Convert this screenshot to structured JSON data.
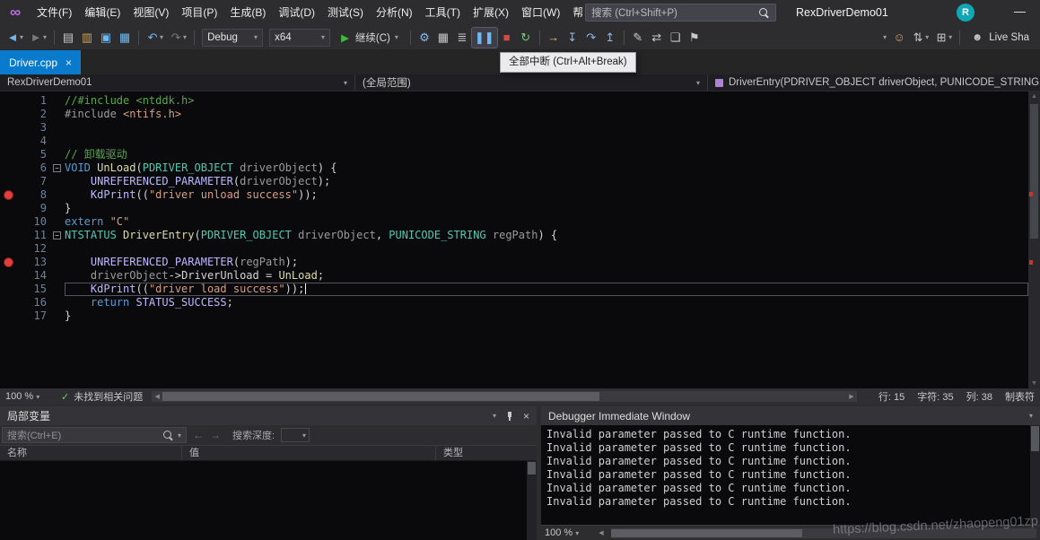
{
  "icons": {
    "chevron": "▾",
    "close": "×",
    "check": "✓",
    "minimize": "—",
    "logo": "∞",
    "scroll_left": "◀",
    "scroll_right": "▶",
    "scroll_up": "▲",
    "scroll_down": "▼",
    "fold_collapse": "−"
  },
  "title_bar": {
    "menus": [
      "文件(F)",
      "编辑(E)",
      "视图(V)",
      "项目(P)",
      "生成(B)",
      "调试(D)",
      "测试(S)",
      "分析(N)",
      "工具(T)",
      "扩展(X)",
      "窗口(W)",
      "帮助(H)"
    ],
    "search_placeholder": "搜索 (Ctrl+Shift+P)",
    "window_title": "RexDriverDemo01",
    "avatar_letter": "R"
  },
  "toolbar": {
    "items": [
      {
        "type": "icon",
        "name": "nav-back-icon",
        "glyph": "◄",
        "color": "#6fb8f2",
        "chev": true
      },
      {
        "type": "icon",
        "name": "nav-forward-icon",
        "glyph": "►",
        "color": "#7a7a7a",
        "chev": true
      },
      {
        "type": "sep"
      },
      {
        "type": "icon",
        "name": "new-file-icon",
        "glyph": "▤",
        "color": "#c8c8c8"
      },
      {
        "type": "icon",
        "name": "open-file-icon",
        "glyph": "▥",
        "color": "#c8a35a"
      },
      {
        "type": "icon",
        "name": "save-icon",
        "glyph": "▣",
        "color": "#6fb8f2"
      },
      {
        "type": "icon",
        "name": "save-all-icon",
        "glyph": "▦",
        "color": "#6fb8f2"
      },
      {
        "type": "sep"
      },
      {
        "type": "icon",
        "name": "undo-icon",
        "glyph": "↶",
        "color": "#6fb8f2",
        "chev": true
      },
      {
        "type": "icon",
        "name": "redo-icon",
        "glyph": "↷",
        "color": "#7a7a7a",
        "chev": true
      },
      {
        "type": "sep"
      },
      {
        "type": "combo",
        "name": "solution-config-dropdown",
        "label": "Debug"
      },
      {
        "type": "combo",
        "name": "platform-dropdown",
        "label": "x64"
      },
      {
        "type": "run",
        "name": "continue-button",
        "glyph": "▶",
        "color": "#3fba41",
        "label": "继续(C)",
        "chev": true
      },
      {
        "type": "sep"
      },
      {
        "type": "icon",
        "name": "quick-attach-icon",
        "glyph": "⚙",
        "color": "#8ab6e8"
      },
      {
        "type": "icon",
        "name": "preview-window-icon",
        "glyph": "▦",
        "color": "#c8c8c8"
      },
      {
        "type": "icon",
        "name": "task-list-icon",
        "glyph": "≣",
        "color": "#c8c8c8"
      },
      {
        "type": "icon",
        "name": "break-all-icon",
        "glyph": "❚❚",
        "color": "#6fb8f2",
        "active": true
      },
      {
        "type": "icon",
        "name": "stop-debug-icon",
        "glyph": "■",
        "color": "#d64a43"
      },
      {
        "type": "icon",
        "name": "restart-debug-icon",
        "glyph": "↻",
        "color": "#7fc97f"
      },
      {
        "type": "sep"
      },
      {
        "type": "icon",
        "name": "show-next-statement-icon",
        "glyph": "→",
        "color": "#d8c36a"
      },
      {
        "type": "icon",
        "name": "step-into-icon",
        "glyph": "↧",
        "color": "#8ab6e8"
      },
      {
        "type": "icon",
        "name": "step-over-icon",
        "glyph": "↷",
        "color": "#8ab6e8"
      },
      {
        "type": "icon",
        "name": "step-out-icon",
        "glyph": "↥",
        "color": "#8ab6e8"
      },
      {
        "type": "sep"
      },
      {
        "type": "icon",
        "name": "code-cleanup-icon",
        "glyph": "✎",
        "color": "#c8c8c8"
      },
      {
        "type": "icon",
        "name": "sync-icon",
        "glyph": "⇄",
        "color": "#c8c8c8"
      },
      {
        "type": "icon",
        "name": "comment-icon",
        "glyph": "❏",
        "color": "#c8c8c8"
      },
      {
        "type": "icon",
        "name": "bookmark-icon",
        "glyph": "⚑",
        "color": "#c8c8c8"
      },
      {
        "type": "spacer"
      },
      {
        "type": "chev",
        "name": "toolbar-options-dropdown"
      },
      {
        "type": "icon",
        "name": "feedback-icon",
        "glyph": "☺",
        "color": "#d9a15e"
      },
      {
        "type": "icon",
        "name": "source-control-icon",
        "glyph": "⇅",
        "color": "#c8c8c8",
        "chev": true
      },
      {
        "type": "icon",
        "name": "window-layout-icon",
        "glyph": "⊞",
        "color": "#c8c8c8",
        "chev": true
      },
      {
        "type": "sep"
      },
      {
        "type": "label-icon",
        "name": "live-share-button",
        "glyph": "☻",
        "color": "#c8c8c8",
        "label": "Live Sha"
      }
    ]
  },
  "tooltip": {
    "text": "全部中断 (Ctrl+Alt+Break)"
  },
  "tab_bar": {
    "tabs": [
      {
        "label": "Driver.cpp"
      }
    ]
  },
  "breadcrumb": {
    "project": "RexDriverDemo01",
    "scope": "(全局范围)",
    "member": "DriverEntry(PDRIVER_OBJECT driverObject, PUNICODE_STRING regP"
  },
  "editor": {
    "breakpoint_lines": [
      8,
      13
    ],
    "current_line": 15,
    "lines": [
      {
        "n": 1,
        "tokens": [
          [
            "//#include <ntddk.h>",
            "com"
          ]
        ]
      },
      {
        "n": 2,
        "tokens": [
          [
            "#include ",
            "pre"
          ],
          [
            "<ntifs.h>",
            "str"
          ]
        ]
      },
      {
        "n": 3,
        "tokens": []
      },
      {
        "n": 4,
        "tokens": []
      },
      {
        "n": 5,
        "tokens": [
          [
            "// 卸载驱动",
            "com"
          ]
        ]
      },
      {
        "n": 6,
        "fold": true,
        "tokens": [
          [
            "VOID",
            "kw"
          ],
          [
            " ",
            "pl"
          ],
          [
            "UnLoad",
            "fn"
          ],
          [
            "(",
            "pl"
          ],
          [
            "PDRIVER_OBJECT",
            "ty"
          ],
          [
            " driverObject",
            "par"
          ],
          [
            ") {",
            "pl"
          ]
        ]
      },
      {
        "n": 7,
        "tokens": [
          [
            "    ",
            "pl"
          ],
          [
            "UNREFERENCED_PARAMETER",
            "mac"
          ],
          [
            "(",
            "pl"
          ],
          [
            "driverObject",
            "par"
          ],
          [
            ");",
            "pl"
          ]
        ]
      },
      {
        "n": 8,
        "bp": true,
        "tokens": [
          [
            "    ",
            "pl"
          ],
          [
            "KdPrint",
            "mac"
          ],
          [
            "((",
            "pl"
          ],
          [
            "\"driver unload success\"",
            "str"
          ],
          [
            "));",
            "pl"
          ]
        ]
      },
      {
        "n": 9,
        "tokens": [
          [
            "}",
            "pl"
          ]
        ]
      },
      {
        "n": 10,
        "tokens": [
          [
            "extern ",
            "kw"
          ],
          [
            "\"C\"",
            "str"
          ]
        ]
      },
      {
        "n": 11,
        "fold": true,
        "tokens": [
          [
            "NTSTATUS",
            "ty"
          ],
          [
            " ",
            "pl"
          ],
          [
            "DriverEntry",
            "fn"
          ],
          [
            "(",
            "pl"
          ],
          [
            "PDRIVER_OBJECT",
            "ty"
          ],
          [
            " driverObject",
            "par"
          ],
          [
            ", ",
            "pl"
          ],
          [
            "PUNICODE_STRING",
            "ty"
          ],
          [
            " regPath",
            "par"
          ],
          [
            ") {",
            "pl"
          ]
        ]
      },
      {
        "n": 12,
        "tokens": []
      },
      {
        "n": 13,
        "bp": true,
        "tokens": [
          [
            "    ",
            "pl"
          ],
          [
            "UNREFERENCED_PARAMETER",
            "mac"
          ],
          [
            "(",
            "pl"
          ],
          [
            "regPath",
            "par"
          ],
          [
            ");",
            "pl"
          ]
        ]
      },
      {
        "n": 14,
        "tokens": [
          [
            "    ",
            "pl"
          ],
          [
            "driverObject",
            "par"
          ],
          [
            "->",
            "pl"
          ],
          [
            "DriverUnload",
            "pl"
          ],
          [
            " = ",
            "pl"
          ],
          [
            "UnLoad",
            "fn"
          ],
          [
            ";",
            "pl"
          ]
        ]
      },
      {
        "n": 15,
        "current": true,
        "caret": true,
        "tokens": [
          [
            "    ",
            "pl"
          ],
          [
            "KdPrint",
            "mac"
          ],
          [
            "((",
            "pl"
          ],
          [
            "\"driver load success\"",
            "str"
          ],
          [
            "));",
            "pl"
          ]
        ]
      },
      {
        "n": 16,
        "tokens": [
          [
            "    ",
            "pl"
          ],
          [
            "return ",
            "kw"
          ],
          [
            "STATUS_SUCCESS",
            "mac"
          ],
          [
            ";",
            "pl"
          ]
        ]
      },
      {
        "n": 17,
        "tokens": [
          [
            "}",
            "pl"
          ]
        ]
      }
    ]
  },
  "editor_status": {
    "zoom": "100 %",
    "health_text": "未找到相关问题",
    "line": "行: 15",
    "char": "字符: 35",
    "col": "列: 38",
    "tabs": "制表符"
  },
  "locals_panel": {
    "title": "局部变量",
    "search_placeholder": "搜索(Ctrl+E)",
    "depth_label": "搜索深度:",
    "columns": [
      "名称",
      "值",
      "类型"
    ]
  },
  "immediate_panel": {
    "title": "Debugger Immediate Window",
    "zoom": "100 %",
    "lines": [
      "Invalid parameter passed to C runtime function.",
      "Invalid parameter passed to C runtime function.",
      "Invalid parameter passed to C runtime function.",
      "Invalid parameter passed to C runtime function.",
      "Invalid parameter passed to C runtime function.",
      "Invalid parameter passed to C runtime function."
    ]
  },
  "watermark": "https://blog.csdn.net/zhaopeng01zp"
}
